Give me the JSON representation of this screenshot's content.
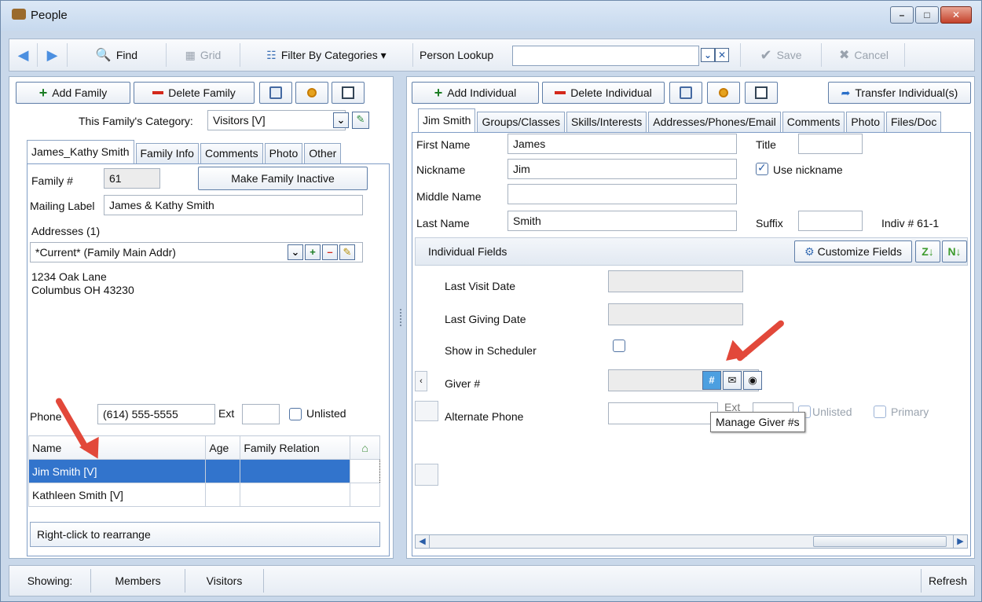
{
  "window": {
    "title": "People"
  },
  "toolbar": {
    "find": "Find",
    "grid": "Grid",
    "filter": "Filter By Categories ▾",
    "person_lookup": "Person Lookup",
    "save": "Save",
    "cancel": "Cancel"
  },
  "family": {
    "add_button": "Add Family",
    "delete_button": "Delete Family",
    "category_label": "This Family's Category:",
    "category_value": "Visitors [V]",
    "tabs": [
      "James_Kathy Smith",
      "Family Info",
      "Comments",
      "Photo",
      "Other"
    ],
    "family_num_label": "Family #",
    "family_num": "61",
    "inactive_button": "Make Family Inactive",
    "mailing_label_label": "Mailing Label",
    "mailing_label": "James & Kathy Smith",
    "addresses_label": "Addresses (1)",
    "address_select": "*Current* (Family Main Addr)",
    "address_line1": "1234 Oak Lane",
    "address_line2": "Columbus OH  43230",
    "phone_label": "Phone",
    "phone": "(614) 555-5555",
    "ext_label": "Ext",
    "unlisted_label": "Unlisted",
    "members_headers": [
      "Name",
      "Age",
      "Family Relation"
    ],
    "members": [
      {
        "name": "Jim Smith [V]",
        "age": "",
        "relation": ""
      },
      {
        "name": "Kathleen Smith [V]",
        "age": "",
        "relation": ""
      }
    ],
    "rearrange": "Right-click to rearrange"
  },
  "individual": {
    "add_button": "Add Individual",
    "delete_button": "Delete Individual",
    "transfer_button": "Transfer Individual(s)",
    "tabs": [
      "Jim Smith",
      "Groups/Classes",
      "Skills/Interests",
      "Addresses/Phones/Email",
      "Comments",
      "Photo",
      "Files/Doc"
    ],
    "first_name_label": "First Name",
    "first_name": "James",
    "title_label": "Title",
    "title": "",
    "nickname_label": "Nickname",
    "nickname": "Jim",
    "use_nickname_label": "Use nickname",
    "middle_name_label": "Middle Name",
    "middle_name": "",
    "last_name_label": "Last Name",
    "last_name": "Smith",
    "suffix_label": "Suffix",
    "suffix": "",
    "indiv_num": "Indiv # 61-1",
    "fields_header": "Individual Fields",
    "customize_button": "Customize Fields",
    "last_visit_label": "Last Visit Date",
    "last_giving_label": "Last Giving Date",
    "scheduler_label": "Show in Scheduler",
    "giver_label": "Giver #",
    "alt_phone_label": "Alternate Phone",
    "ext_label": "Ext",
    "unlisted_label": "Unlisted",
    "primary_label": "Primary",
    "tooltip": "Manage Giver #s"
  },
  "status": {
    "showing": "Showing:",
    "members": "Members",
    "visitors": "Visitors",
    "refresh": "Refresh"
  },
  "colors": {
    "accent_red": "#e2483a",
    "selection": "#3274cc"
  }
}
